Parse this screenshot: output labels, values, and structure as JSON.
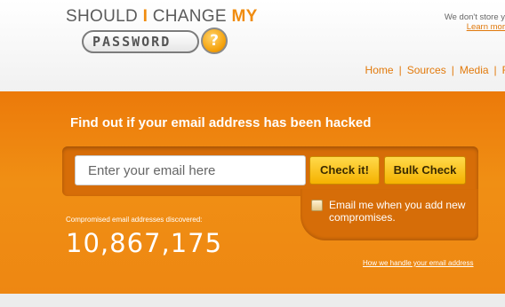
{
  "logo": {
    "line1_prefix": "SHOULD",
    "line1_accent": "I",
    "line1_suffix": "CHANGE",
    "line1_accent2": "MY",
    "pill_text": "PASSWORD",
    "badge_glyph": "?"
  },
  "disclaimer": {
    "line1": "We don't store y",
    "learn_more": "Learn mor"
  },
  "nav": {
    "items": [
      "Home",
      "Sources",
      "Media",
      "F"
    ]
  },
  "hero": {
    "headline": "Find out if your email address has been hacked",
    "email_placeholder": "Enter your email here",
    "check_button": "Check it!",
    "bulk_button": "Bulk Check",
    "notify_label": "Email me when you add new compromises.",
    "count_label": "Compromised email addresses discovered:",
    "count_value": "10,867,175",
    "privacy_link": "How we handle your email address"
  },
  "colors": {
    "accent": "#f08c10",
    "hero_bg": "#ec7a0a",
    "button": "#f5b200"
  }
}
